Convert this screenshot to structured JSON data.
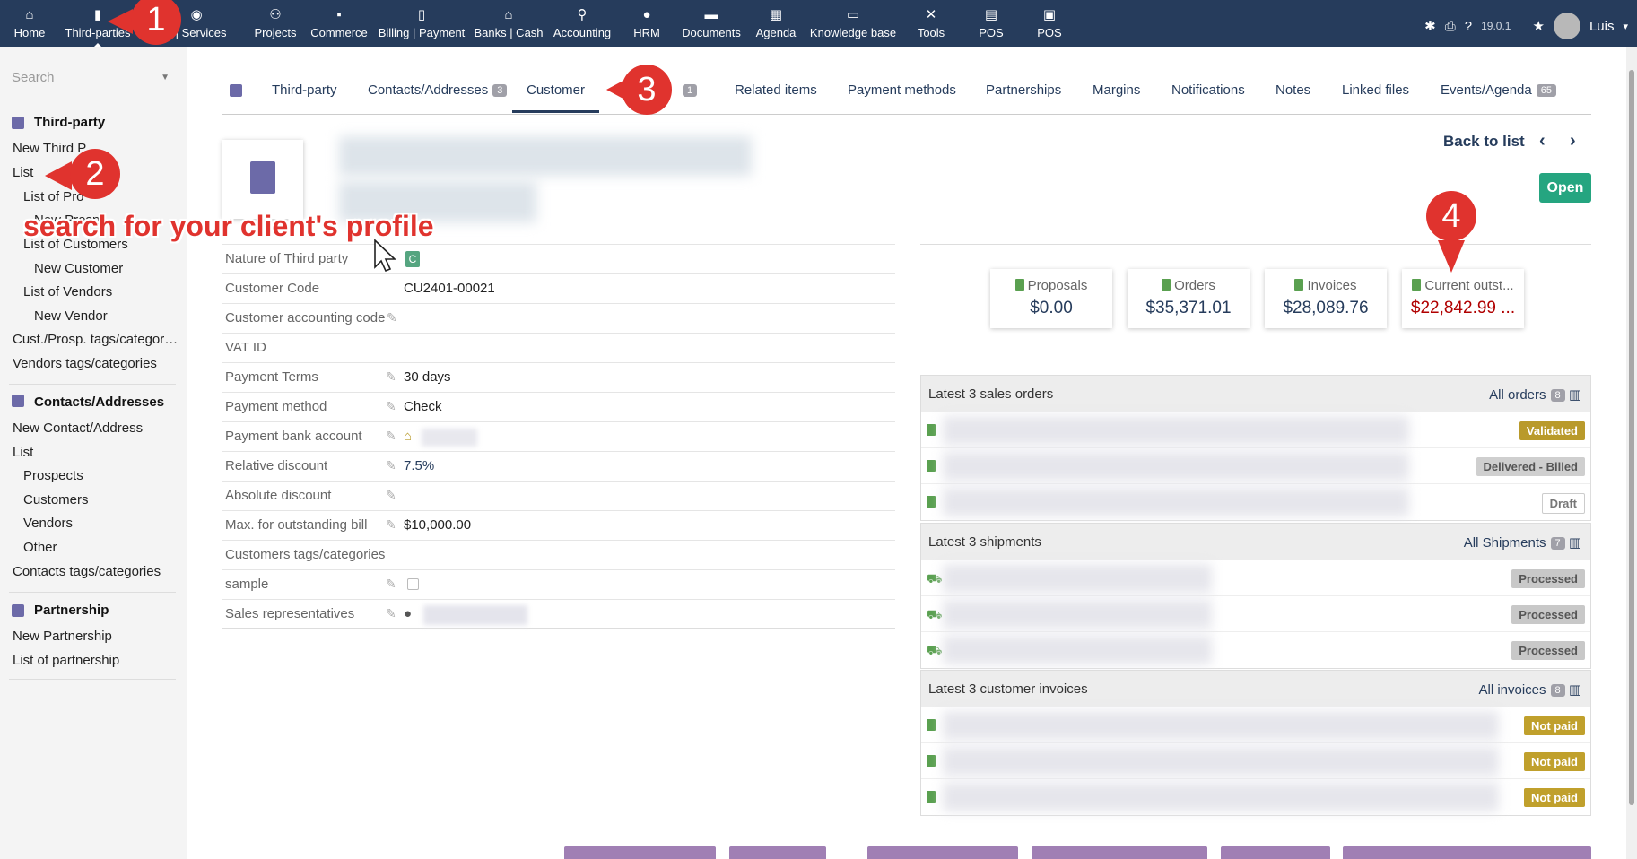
{
  "topbar": {
    "menus": [
      {
        "label": "Home",
        "icon": "home-icon"
      },
      {
        "label": "Third-parties",
        "icon": "building-icon"
      },
      {
        "label": "s | Services",
        "icon": "product-icon"
      },
      {
        "label": "Projects",
        "icon": "project-icon"
      },
      {
        "label": "Commerce",
        "icon": "briefcase-icon"
      },
      {
        "label": "Billing | Payment",
        "icon": "invoice-icon"
      },
      {
        "label": "Banks | Cash",
        "icon": "bank-icon"
      },
      {
        "label": "Accounting",
        "icon": "search-icon"
      },
      {
        "label": "HRM",
        "icon": "user-icon"
      },
      {
        "label": "Documents",
        "icon": "folder-icon"
      },
      {
        "label": "Agenda",
        "icon": "calendar-icon"
      },
      {
        "label": "Knowledge base",
        "icon": "ticket-icon"
      },
      {
        "label": "Tools",
        "icon": "tools-icon"
      },
      {
        "label": "POS",
        "icon": "cash-register-icon"
      },
      {
        "label": "POS",
        "icon": "pos-icon"
      }
    ],
    "version": "19.0.1",
    "user": "Luis"
  },
  "sidebar": {
    "search_placeholder": "Search",
    "third_party_title": "Third-party",
    "new_third_party": "New Third P",
    "list": "List",
    "list_prospects": "List of Pro",
    "new_prospect": "New Prosp",
    "list_customers": "List of Customers",
    "new_customer": "New Customer",
    "list_vendors": "List of Vendors",
    "new_vendor": "New Vendor",
    "cust_tags": "Cust./Prosp. tags/categor…",
    "vendor_tags": "Vendors tags/categories",
    "contacts_title": "Contacts/Addresses",
    "new_contact": "New Contact/Address",
    "contacts_list": "List",
    "prospects": "Prospects",
    "customers": "Customers",
    "vendors": "Vendors",
    "other": "Other",
    "contact_tags": "Contacts tags/categories",
    "partnership_title": "Partnership",
    "new_partnership": "New Partnership",
    "list_partnership": "List of partnership"
  },
  "tabs": [
    {
      "label": "Third-party",
      "badge": ""
    },
    {
      "label": "Contacts/Addresses",
      "badge": "3"
    },
    {
      "label": "Customer",
      "badge": ""
    },
    {
      "label": "",
      "badge": "1"
    },
    {
      "label": "Related items",
      "badge": ""
    },
    {
      "label": "Payment methods",
      "badge": ""
    },
    {
      "label": "Partnerships",
      "badge": ""
    },
    {
      "label": "Margins",
      "badge": ""
    },
    {
      "label": "Notifications",
      "badge": ""
    },
    {
      "label": "Notes",
      "badge": ""
    },
    {
      "label": "Linked files",
      "badge": ""
    },
    {
      "label": "Events/Agenda",
      "badge": "65"
    }
  ],
  "header": {
    "back_to_list": "Back to list",
    "prev": "‹",
    "next": "›",
    "status": "Open"
  },
  "fields": [
    {
      "label": "Nature of Third party",
      "value": "C",
      "editable": false
    },
    {
      "label": "Customer Code",
      "value": "CU2401-00021",
      "editable": false
    },
    {
      "label": "Customer accounting code",
      "value": "",
      "editable": true
    },
    {
      "label": "VAT ID",
      "value": "",
      "editable": false
    },
    {
      "label": "Payment Terms",
      "value": "30 days",
      "editable": true
    },
    {
      "label": "Payment method",
      "value": "Check",
      "editable": true
    },
    {
      "label": "Payment bank account",
      "value": "",
      "editable": true
    },
    {
      "label": "Relative discount",
      "value": "7.5%",
      "editable": true
    },
    {
      "label": "Absolute discount",
      "value": "",
      "editable": true
    },
    {
      "label": "Max. for outstanding bill",
      "value": "$10,000.00",
      "editable": true
    },
    {
      "label": "Customers tags/categories",
      "value": "",
      "editable": false
    },
    {
      "label": "sample",
      "value": "",
      "editable": true
    },
    {
      "label": "Sales representatives",
      "value": "",
      "editable": true
    }
  ],
  "stats": [
    {
      "label": "Proposals",
      "value": "$0.00"
    },
    {
      "label": "Orders",
      "value": "$35,371.01"
    },
    {
      "label": "Invoices",
      "value": "$28,089.76"
    },
    {
      "label": "Current outst...",
      "value": "$22,842.99 ..."
    }
  ],
  "orders": {
    "title": "Latest 3 sales orders",
    "all_label": "All orders",
    "count": "8",
    "statuses": [
      "Validated",
      "Delivered - Billed",
      "Draft"
    ]
  },
  "shipments": {
    "title": "Latest 3 shipments",
    "all_label": "All Shipments",
    "count": "7",
    "statuses": [
      "Processed",
      "Processed",
      "Processed"
    ]
  },
  "invoices": {
    "title": "Latest 3 customer invoices",
    "all_label": "All invoices",
    "count": "8",
    "statuses": [
      "Not paid",
      "Not paid",
      "Not paid"
    ]
  },
  "annotations": {
    "markers": [
      "1",
      "2",
      "3",
      "4"
    ],
    "note": "search for your client's profile"
  },
  "colors": {
    "topbar": "#263c5c",
    "marker": "#e0332e",
    "open_status": "#25a580",
    "validated": "#b99a2b",
    "not_paid": "#c0a02c"
  }
}
